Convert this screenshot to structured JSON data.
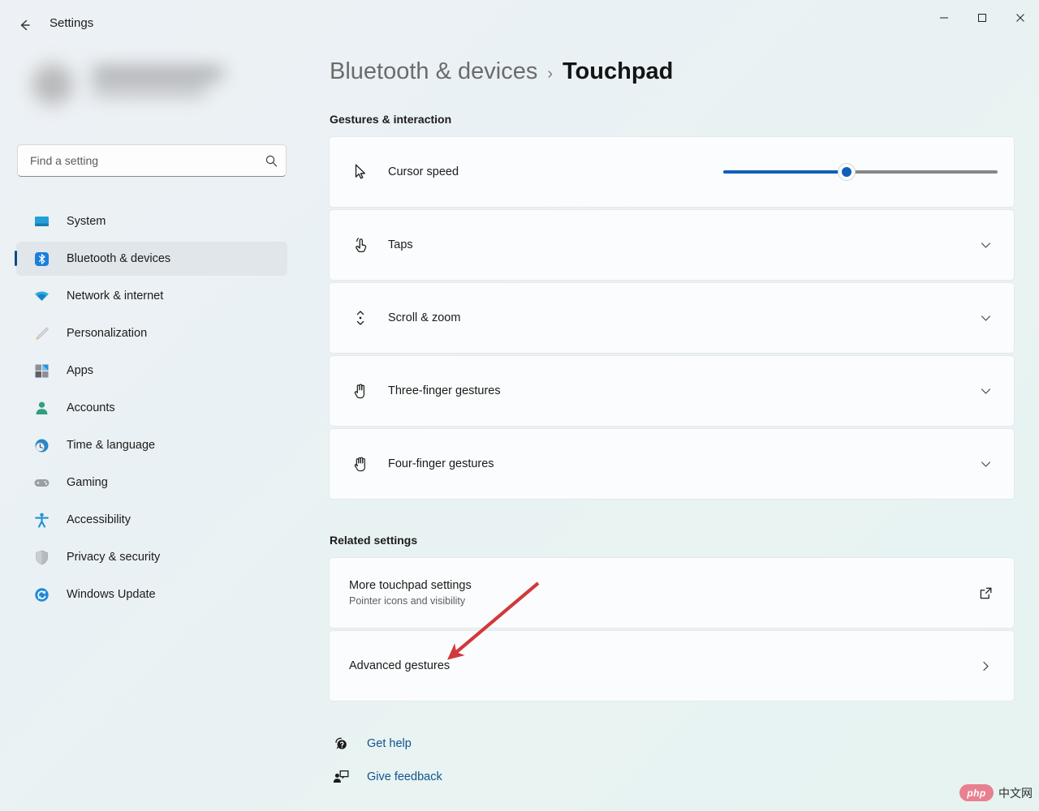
{
  "window": {
    "app_title": "Settings",
    "back_icon": "back-arrow-icon",
    "minimize_label": "—",
    "maximize_label": "□",
    "close_label": "✕"
  },
  "sidebar": {
    "profile": {
      "redacted": "blurred user account name and email"
    },
    "search": {
      "placeholder": "Find a setting",
      "value": "",
      "icon": "search-icon"
    },
    "items": [
      {
        "label": "System",
        "icon": "system-monitor-icon",
        "selected": false
      },
      {
        "label": "Bluetooth & devices",
        "icon": "bluetooth-icon",
        "selected": true
      },
      {
        "label": "Network & internet",
        "icon": "wifi-icon",
        "selected": false
      },
      {
        "label": "Personalization",
        "icon": "paintbrush-icon",
        "selected": false
      },
      {
        "label": "Apps",
        "icon": "apps-grid-icon",
        "selected": false
      },
      {
        "label": "Accounts",
        "icon": "person-icon",
        "selected": false
      },
      {
        "label": "Time & language",
        "icon": "clock-globe-icon",
        "selected": false
      },
      {
        "label": "Gaming",
        "icon": "gamepad-icon",
        "selected": false
      },
      {
        "label": "Accessibility",
        "icon": "accessibility-icon",
        "selected": false
      },
      {
        "label": "Privacy & security",
        "icon": "shield-icon",
        "selected": false
      },
      {
        "label": "Windows Update",
        "icon": "update-refresh-icon",
        "selected": false
      }
    ]
  },
  "header": {
    "breadcrumb_parent": "Bluetooth & devices",
    "breadcrumb_separator": "›",
    "breadcrumb_current": "Touchpad"
  },
  "main": {
    "sections": {
      "gestures_title": "Gestures & interaction",
      "related_title": "Related settings"
    },
    "cursor_speed": {
      "label": "Cursor speed",
      "icon": "mouse-pointer-icon",
      "slider_percent": 45,
      "fill_color": "#0f5fb8",
      "track_color": "#868686"
    },
    "gesture_rows": [
      {
        "label": "Taps",
        "icon": "tap-hand-icon",
        "expander": "chevron-down-icon"
      },
      {
        "label": "Scroll & zoom",
        "icon": "scroll-updown-icon",
        "expander": "chevron-down-icon"
      },
      {
        "label": "Three-finger gestures",
        "icon": "three-finger-hand-icon",
        "expander": "chevron-down-icon"
      },
      {
        "label": "Four-finger gestures",
        "icon": "four-finger-hand-icon",
        "expander": "chevron-down-icon"
      }
    ],
    "related_rows": [
      {
        "title": "More touchpad settings",
        "subtitle": "Pointer icons and visibility",
        "trail_icon": "external-link-icon"
      },
      {
        "title": "Advanced gestures",
        "subtitle": "",
        "trail_icon": "chevron-right-icon"
      }
    ],
    "footer_links": [
      {
        "label": "Get help",
        "icon": "help-question-icon",
        "color": "#10538f"
      },
      {
        "label": "Give feedback",
        "icon": "feedback-chat-icon",
        "color": "#10538f"
      }
    ]
  },
  "annotation": {
    "arrow_color": "#d03a3a",
    "points_to": "Advanced gestures"
  },
  "watermark": {
    "logo_text": "php",
    "site_text": "中文网",
    "logo_color": "#e8808f"
  }
}
